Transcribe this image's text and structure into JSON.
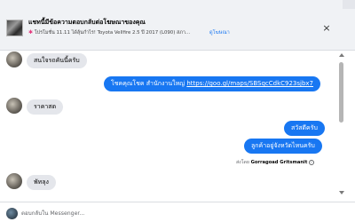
{
  "ad": {
    "title": "แชทนี้มีข้อความตอบกลับต่อโฆษณาของคุณ",
    "subtitle": "โปรโมชั่น 11.11 ได้ลุ้นกำไร! Toyota Vellfire 2.5 ปี 2017 (L090) สภา...",
    "view_ad_label": "ดูโฆษณา",
    "close_label": "×"
  },
  "messages": [
    {
      "side": "in",
      "text": "สนใจรถคันนี้ครับ"
    },
    {
      "side": "out",
      "text_prefix": "โชคคุณโชค สำนักงานใหญ่ ",
      "link": "https://goo.gl/maps/SBSqcCdkC923sjbx7"
    },
    {
      "side": "in",
      "text": "ราคาสด"
    },
    {
      "side": "out",
      "text": "สวัสดีครับ"
    },
    {
      "side": "out",
      "text": "ลูกค้าอยู่จังหวัดไหนครับ"
    },
    {
      "side": "in",
      "text": "พัทลุง"
    }
  ],
  "sent_by": {
    "prefix": "ส่งโดย",
    "name": "Gorragoad Gritsmanit",
    "info": "i"
  },
  "composer": {
    "placeholder": "ตอบกลับใน Messenger..."
  },
  "colors": {
    "outgoing": "#1877f2",
    "incoming": "#e4e6eb",
    "link": "#1877f2"
  }
}
